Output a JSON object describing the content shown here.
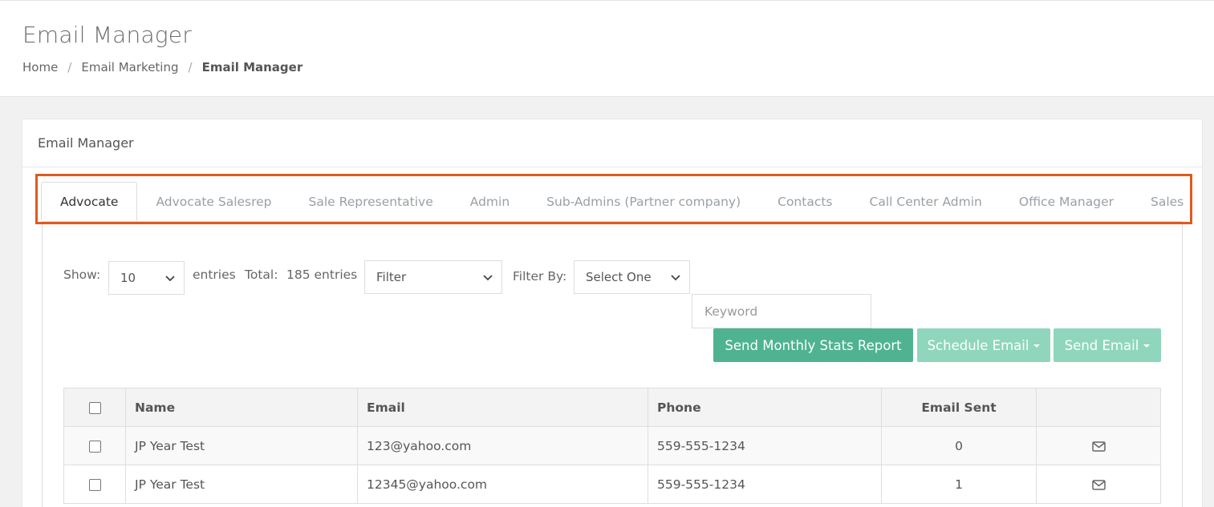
{
  "page": {
    "title": "Email Manager",
    "breadcrumb": [
      "Home",
      "Email Marketing",
      "Email Manager"
    ]
  },
  "panel": {
    "title": "Email Manager",
    "tabs": [
      {
        "label": "Advocate",
        "active": true
      },
      {
        "label": "Advocate Salesrep",
        "active": false
      },
      {
        "label": "Sale Representative",
        "active": false
      },
      {
        "label": "Admin",
        "active": false
      },
      {
        "label": "Sub-Admins (Partner company)",
        "active": false
      },
      {
        "label": "Contacts",
        "active": false
      },
      {
        "label": "Call Center Admin",
        "active": false
      },
      {
        "label": "Office Manager",
        "active": false
      },
      {
        "label": "Sales",
        "active": false
      }
    ]
  },
  "controls": {
    "show_label": "Show:",
    "show_value": "10",
    "entries_label": "entries",
    "total_label": "Total:",
    "total_value": "185 entries",
    "filter_value": "Filter",
    "filter_by_label": "Filter By:",
    "filter_by_value": "Select One",
    "keyword_placeholder": "Keyword",
    "send_monthly_label": "Send Monthly Stats Report",
    "schedule_label": "Schedule Email",
    "send_email_label": "Send Email"
  },
  "table": {
    "headers": [
      "",
      "Name",
      "Email",
      "Phone",
      "Email Sent",
      ""
    ],
    "rows": [
      {
        "name": "JP Year Test",
        "email": "123@yahoo.com",
        "phone": "559-555-1234",
        "sent": "0"
      },
      {
        "name": "JP Year Test",
        "email": "12345@yahoo.com",
        "phone": "559-555-1234",
        "sent": "1"
      }
    ]
  },
  "colors": {
    "accent": "#4fb391",
    "accent_light": "#8fd6bd",
    "highlight": "#e05a1b"
  }
}
